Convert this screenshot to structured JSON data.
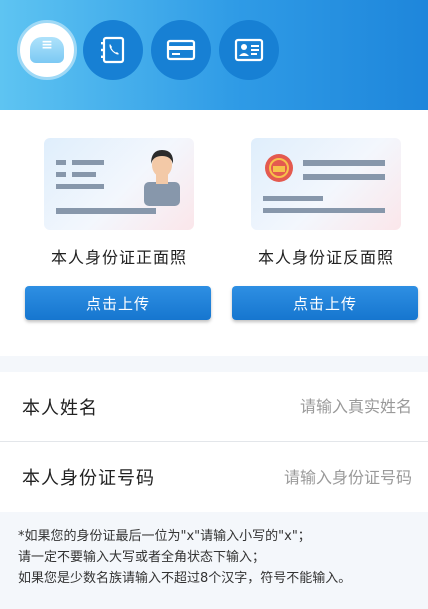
{
  "header": {
    "steps": [
      {
        "icon": "menu-icon",
        "label": "≡",
        "active": true
      },
      {
        "icon": "phone-book-icon",
        "active": false
      },
      {
        "icon": "bank-card-icon",
        "active": false
      },
      {
        "icon": "id-card-icon",
        "active": false
      }
    ]
  },
  "upload": {
    "front": {
      "caption": "本人身份证正面照",
      "button": "点击上传"
    },
    "back": {
      "caption": "本人身份证反面照",
      "button": "点击上传"
    }
  },
  "form": {
    "name": {
      "label": "本人姓名",
      "placeholder": "请输入真实姓名"
    },
    "id_number": {
      "label": "本人身份证号码",
      "placeholder": "请输入身份证号码"
    }
  },
  "notes": [
    "*如果您的身份证最后一位为\"x\"请输入小写的\"x\"；",
    "请一定不要输入大写或者全角状态下输入；",
    "如果您是少数名族请输入不超过8个汉字，符号不能输入。"
  ],
  "colors": {
    "primary": "#1a7ed6",
    "header_start": "#5ec4f2",
    "header_end": "#1e86db"
  }
}
